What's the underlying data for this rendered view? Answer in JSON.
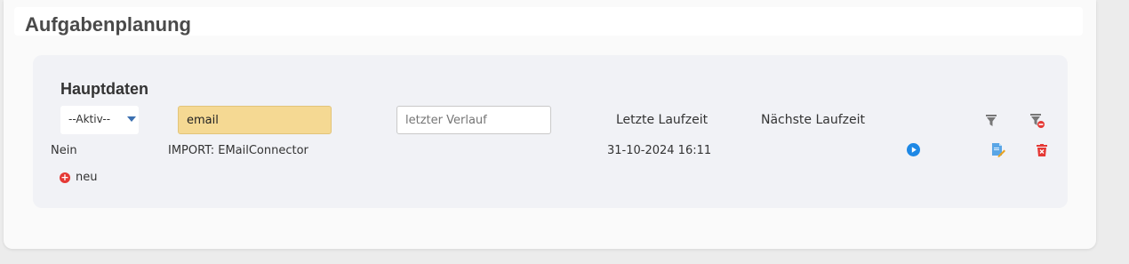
{
  "page": {
    "title": "Aufgabenplanung"
  },
  "section": {
    "title": "Hauptdaten"
  },
  "filters": {
    "status_value": "--Aktiv--",
    "name_value": "email",
    "history_placeholder": "letzter Verlauf"
  },
  "columns": {
    "last_run": "Letzte Laufzeit",
    "next_run": "Nächste Laufzeit"
  },
  "rows": [
    {
      "active": "Nein",
      "name": "IMPORT: EMailConnector",
      "last_run": "31-10-2024 16:11",
      "next_run": ""
    }
  ],
  "actions": {
    "new_label": "neu"
  },
  "icons": {
    "filter": "filter-icon",
    "filter_clear": "filter-clear-icon",
    "play": "play-icon",
    "edit": "edit-icon",
    "delete": "trash-icon",
    "add": "plus-circle-icon"
  },
  "colors": {
    "name_filter_bg": "#f5d993",
    "play": "#1e88e5",
    "delete": "#e53935",
    "add": "#e53935"
  }
}
